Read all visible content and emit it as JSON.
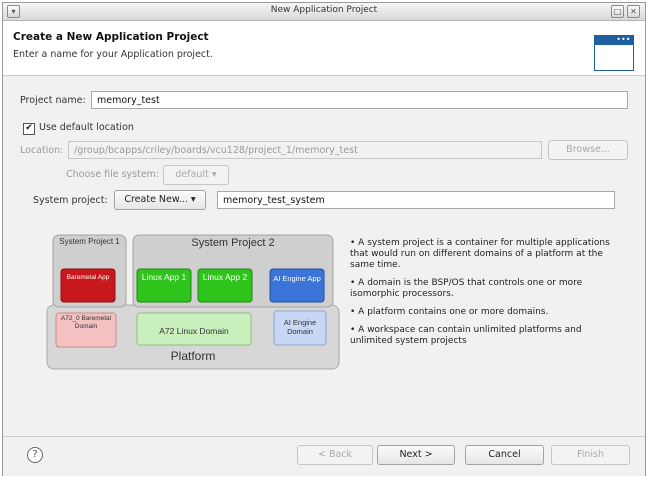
{
  "window": {
    "title": "New Application Project"
  },
  "header": {
    "title": "Create a New Application Project",
    "subtitle": "Enter a name for your Application project."
  },
  "form": {
    "project_name_label": "Project name:",
    "project_name_value": "memory_test",
    "use_default_location_label": "Use default location",
    "use_default_location_checked": true,
    "location_label": "Location:",
    "location_value": "/group/bcapps/criley/boards/vcu128/project_1/memory_test",
    "browse_label": "Browse...",
    "choose_fs_label": "Choose file system:",
    "choose_fs_value": "default",
    "system_project_label": "System project:",
    "system_project_dropdown": "Create New...",
    "system_project_name": "memory_test_system"
  },
  "diagram": {
    "system_project_1": "System Project 1",
    "system_project_2": "System Project 2",
    "baremetal_app": "Baremetal App",
    "linux_app_1": "Linux App 1",
    "linux_app_2": "Linux App 2",
    "ai_engine_app": "AI Engine App",
    "a72_baremetal_domain": "A72_0 Baremetal Domain",
    "a72_linux_domain": "A72 Linux Domain",
    "ai_engine_domain": "AI Engine Domain",
    "platform": "Platform"
  },
  "bullets": [
    "A system project is a container for multiple applications that would run on different domains of a platform at the same time.",
    "A domain is the BSP/OS that controls one or more isomorphic processors.",
    "A platform contains one or more domains.",
    "A workspace can contain unlimited platforms and unlimited system projects"
  ],
  "footer": {
    "back": "< Back",
    "next": "Next >",
    "cancel": "Cancel",
    "finish": "Finish"
  },
  "colors": {
    "baremetal": "#c8181b",
    "linux": "#2ec41c",
    "ai_engine": "#3b74d8",
    "banner": "#1d5fa0"
  }
}
